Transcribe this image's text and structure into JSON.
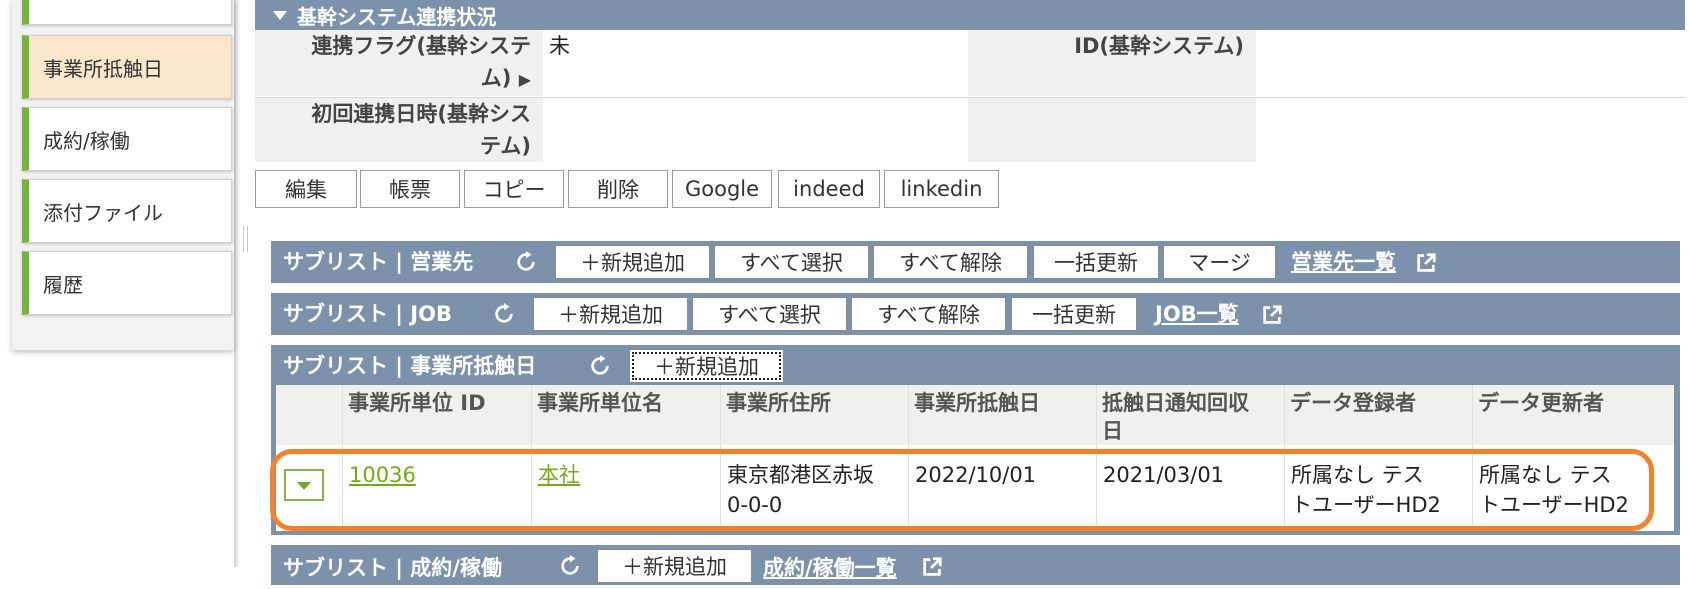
{
  "sidebar": {
    "items": [
      {
        "label": "事業所抵触日",
        "active": true
      },
      {
        "label": "成約/稼働",
        "active": false
      },
      {
        "label": "添付ファイル",
        "active": false
      },
      {
        "label": "履歴",
        "active": false
      }
    ]
  },
  "section": {
    "title": "基幹システム連携状況",
    "fields": {
      "link_flag_label_line1": "連携フラグ(基幹システ",
      "link_flag_label_line2": "ム)",
      "link_flag_value": "未",
      "id_label": "ID(基幹システム)",
      "first_link_label_line1": "初回連携日時(基幹シス",
      "first_link_label_line2": "テム)"
    }
  },
  "actions": [
    "編集",
    "帳票",
    "コピー",
    "削除",
    "Google",
    "indeed",
    "linkedin"
  ],
  "sublists": {
    "eigyo": {
      "title": "サブリスト | 営業先",
      "buttons": [
        "＋新規追加",
        "すべて選択",
        "すべて解除",
        "一括更新",
        "マージ"
      ],
      "link": "営業先一覧"
    },
    "job": {
      "title": "サブリスト | JOB",
      "buttons": [
        "＋新規追加",
        "すべて選択",
        "すべて解除",
        "一括更新"
      ],
      "link": "JOB一覧"
    },
    "office": {
      "title": "サブリスト | 事業所抵触日",
      "buttons": [
        "＋新規追加"
      ],
      "columns": [
        "事業所単位 ID",
        "事業所単位名",
        "事業所住所",
        "事業所抵触日",
        "抵触日通知回収",
        "日",
        "データ登録者",
        "データ更新者"
      ],
      "rows": [
        {
          "id": "10036",
          "name": "本社",
          "address_line1": "東京都港区赤坂",
          "address_line2": "0-0-0",
          "conflict_date": "2022/10/01",
          "notice_date": "2021/03/01",
          "registrar_line1": "所属なし テス",
          "registrar_line2": "トユーザーHD2",
          "updater_line1": "所属なし テス",
          "updater_line2": "トユーザーHD2"
        }
      ]
    },
    "contract": {
      "title": "サブリスト | 成約/稼働",
      "buttons": [
        "＋新規追加"
      ],
      "link": "成約/稼働一覧"
    }
  },
  "colors": {
    "bar": "#7b92aa",
    "accent_green": "#78b43c",
    "highlight": "#f5812a"
  }
}
